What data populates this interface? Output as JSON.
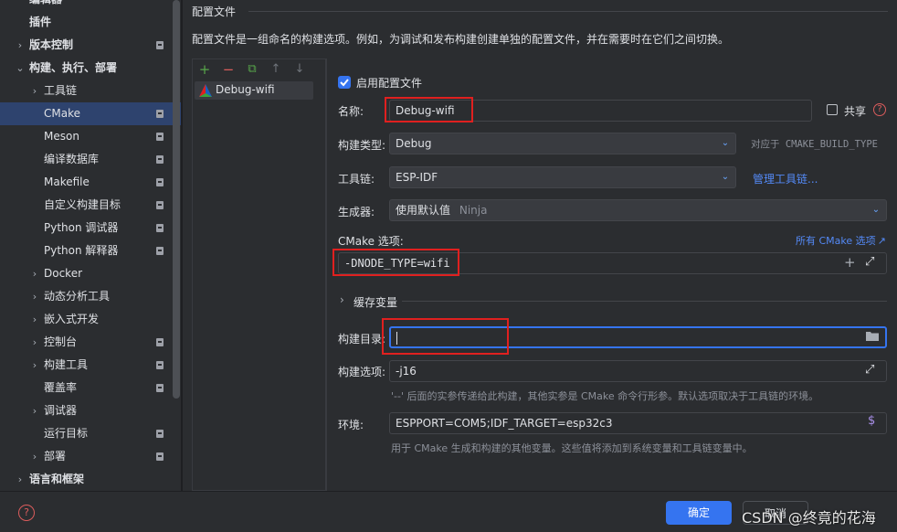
{
  "sidebar": {
    "items": [
      {
        "label": "编辑器",
        "chev": "",
        "bold": true
      },
      {
        "label": "插件",
        "chev": "",
        "bold": true
      },
      {
        "label": "版本控制",
        "chev": "›",
        "bold": true,
        "badge": true
      },
      {
        "label": "构建、执行、部署",
        "chev": "⌄",
        "bold": true
      },
      {
        "label": "工具链",
        "chev": "›"
      },
      {
        "label": "CMake",
        "chev": "",
        "badge": true,
        "selected": true
      },
      {
        "label": "Meson",
        "chev": "",
        "badge": true
      },
      {
        "label": "编译数据库",
        "chev": "",
        "badge": true
      },
      {
        "label": "Makefile",
        "chev": "",
        "badge": true
      },
      {
        "label": "自定义构建目标",
        "chev": "",
        "badge": true
      },
      {
        "label": "Python 调试器",
        "chev": "",
        "badge": true
      },
      {
        "label": "Python 解释器",
        "chev": "",
        "badge": true
      },
      {
        "label": "Docker",
        "chev": "›"
      },
      {
        "label": "动态分析工具",
        "chev": "›"
      },
      {
        "label": "嵌入式开发",
        "chev": "›"
      },
      {
        "label": "控制台",
        "chev": "›",
        "badge": true
      },
      {
        "label": "构建工具",
        "chev": "›",
        "badge": true
      },
      {
        "label": "覆盖率",
        "chev": "",
        "badge": true
      },
      {
        "label": "调试器",
        "chev": "›"
      },
      {
        "label": "运行目标",
        "chev": "",
        "badge": true
      },
      {
        "label": "部署",
        "chev": "›",
        "badge": true
      },
      {
        "label": "语言和框架",
        "chev": "›",
        "bold": true
      }
    ]
  },
  "section_title": "配置文件",
  "description": "配置文件是一组命名的构建选项。例如，为调试和发布构建创建单独的配置文件，并在需要时在它们之间切换。",
  "toolbar": {
    "add": "+",
    "remove": "−",
    "copy": "⧉",
    "up": "↑",
    "down": "↓"
  },
  "profiles": [
    {
      "name": "Debug-wifi"
    }
  ],
  "form": {
    "enable_label": "启用配置文件",
    "name_label": "名称:",
    "name_value": "Debug-wifi",
    "share_label": "共享",
    "build_type_label": "构建类型:",
    "build_type_value": "Debug",
    "build_type_hint": "对应于 CMAKE_BUILD_TYPE",
    "toolchain_label": "工具链:",
    "toolchain_value": "ESP-IDF",
    "manage_toolchains": "管理工具链...",
    "generator_label": "生成器:",
    "generator_value": "使用默认值",
    "generator_hint": "Ninja",
    "cmake_options_label": "CMake 选项:",
    "all_cmake_options": "所有 CMake 选项",
    "cmake_options_value": "-DNODE_TYPE=wifi",
    "cache_vars_label": "缓存变量",
    "build_dir_label": "构建目录:",
    "build_dir_value": "",
    "build_options_label": "构建选项:",
    "build_options_value": "-j16",
    "build_options_hint": "'--' 后面的实参传递给此构建，其他实参是 CMake 命令行形参。默认选项取决于工具链的环境。",
    "env_label": "环境:",
    "env_value": "ESPPORT=COM5;IDF_TARGET=esp32c3",
    "env_hint": "用于 CMake 生成和构建的其他变量。这些值将添加到系统变量和工具链变量中。"
  },
  "footer": {
    "ok": "确定",
    "cancel": "取消",
    "watermark": "CSDN @终竟的花海"
  },
  "colors": {
    "accent": "#3574f0",
    "selection": "#2e436e",
    "highlight_box": "#e0201f",
    "link": "#548af7"
  }
}
